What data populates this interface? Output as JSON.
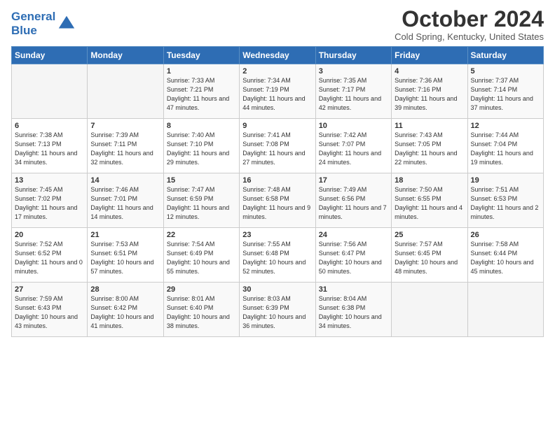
{
  "header": {
    "logo_line1": "General",
    "logo_line2": "Blue",
    "month": "October 2024",
    "location": "Cold Spring, Kentucky, United States"
  },
  "days_of_week": [
    "Sunday",
    "Monday",
    "Tuesday",
    "Wednesday",
    "Thursday",
    "Friday",
    "Saturday"
  ],
  "weeks": [
    [
      {
        "day": "",
        "info": ""
      },
      {
        "day": "",
        "info": ""
      },
      {
        "day": "1",
        "sunrise": "7:33 AM",
        "sunset": "7:21 PM",
        "daylight": "11 hours and 47 minutes."
      },
      {
        "day": "2",
        "sunrise": "7:34 AM",
        "sunset": "7:19 PM",
        "daylight": "11 hours and 44 minutes."
      },
      {
        "day": "3",
        "sunrise": "7:35 AM",
        "sunset": "7:17 PM",
        "daylight": "11 hours and 42 minutes."
      },
      {
        "day": "4",
        "sunrise": "7:36 AM",
        "sunset": "7:16 PM",
        "daylight": "11 hours and 39 minutes."
      },
      {
        "day": "5",
        "sunrise": "7:37 AM",
        "sunset": "7:14 PM",
        "daylight": "11 hours and 37 minutes."
      }
    ],
    [
      {
        "day": "6",
        "sunrise": "7:38 AM",
        "sunset": "7:13 PM",
        "daylight": "11 hours and 34 minutes."
      },
      {
        "day": "7",
        "sunrise": "7:39 AM",
        "sunset": "7:11 PM",
        "daylight": "11 hours and 32 minutes."
      },
      {
        "day": "8",
        "sunrise": "7:40 AM",
        "sunset": "7:10 PM",
        "daylight": "11 hours and 29 minutes."
      },
      {
        "day": "9",
        "sunrise": "7:41 AM",
        "sunset": "7:08 PM",
        "daylight": "11 hours and 27 minutes."
      },
      {
        "day": "10",
        "sunrise": "7:42 AM",
        "sunset": "7:07 PM",
        "daylight": "11 hours and 24 minutes."
      },
      {
        "day": "11",
        "sunrise": "7:43 AM",
        "sunset": "7:05 PM",
        "daylight": "11 hours and 22 minutes."
      },
      {
        "day": "12",
        "sunrise": "7:44 AM",
        "sunset": "7:04 PM",
        "daylight": "11 hours and 19 minutes."
      }
    ],
    [
      {
        "day": "13",
        "sunrise": "7:45 AM",
        "sunset": "7:02 PM",
        "daylight": "11 hours and 17 minutes."
      },
      {
        "day": "14",
        "sunrise": "7:46 AM",
        "sunset": "7:01 PM",
        "daylight": "11 hours and 14 minutes."
      },
      {
        "day": "15",
        "sunrise": "7:47 AM",
        "sunset": "6:59 PM",
        "daylight": "11 hours and 12 minutes."
      },
      {
        "day": "16",
        "sunrise": "7:48 AM",
        "sunset": "6:58 PM",
        "daylight": "11 hours and 9 minutes."
      },
      {
        "day": "17",
        "sunrise": "7:49 AM",
        "sunset": "6:56 PM",
        "daylight": "11 hours and 7 minutes."
      },
      {
        "day": "18",
        "sunrise": "7:50 AM",
        "sunset": "6:55 PM",
        "daylight": "11 hours and 4 minutes."
      },
      {
        "day": "19",
        "sunrise": "7:51 AM",
        "sunset": "6:53 PM",
        "daylight": "11 hours and 2 minutes."
      }
    ],
    [
      {
        "day": "20",
        "sunrise": "7:52 AM",
        "sunset": "6:52 PM",
        "daylight": "11 hours and 0 minutes."
      },
      {
        "day": "21",
        "sunrise": "7:53 AM",
        "sunset": "6:51 PM",
        "daylight": "10 hours and 57 minutes."
      },
      {
        "day": "22",
        "sunrise": "7:54 AM",
        "sunset": "6:49 PM",
        "daylight": "10 hours and 55 minutes."
      },
      {
        "day": "23",
        "sunrise": "7:55 AM",
        "sunset": "6:48 PM",
        "daylight": "10 hours and 52 minutes."
      },
      {
        "day": "24",
        "sunrise": "7:56 AM",
        "sunset": "6:47 PM",
        "daylight": "10 hours and 50 minutes."
      },
      {
        "day": "25",
        "sunrise": "7:57 AM",
        "sunset": "6:45 PM",
        "daylight": "10 hours and 48 minutes."
      },
      {
        "day": "26",
        "sunrise": "7:58 AM",
        "sunset": "6:44 PM",
        "daylight": "10 hours and 45 minutes."
      }
    ],
    [
      {
        "day": "27",
        "sunrise": "7:59 AM",
        "sunset": "6:43 PM",
        "daylight": "10 hours and 43 minutes."
      },
      {
        "day": "28",
        "sunrise": "8:00 AM",
        "sunset": "6:42 PM",
        "daylight": "10 hours and 41 minutes."
      },
      {
        "day": "29",
        "sunrise": "8:01 AM",
        "sunset": "6:40 PM",
        "daylight": "10 hours and 38 minutes."
      },
      {
        "day": "30",
        "sunrise": "8:03 AM",
        "sunset": "6:39 PM",
        "daylight": "10 hours and 36 minutes."
      },
      {
        "day": "31",
        "sunrise": "8:04 AM",
        "sunset": "6:38 PM",
        "daylight": "10 hours and 34 minutes."
      },
      {
        "day": "",
        "info": ""
      },
      {
        "day": "",
        "info": ""
      }
    ]
  ],
  "labels": {
    "sunrise_label": "Sunrise:",
    "sunset_label": "Sunset:",
    "daylight_label": "Daylight:"
  }
}
